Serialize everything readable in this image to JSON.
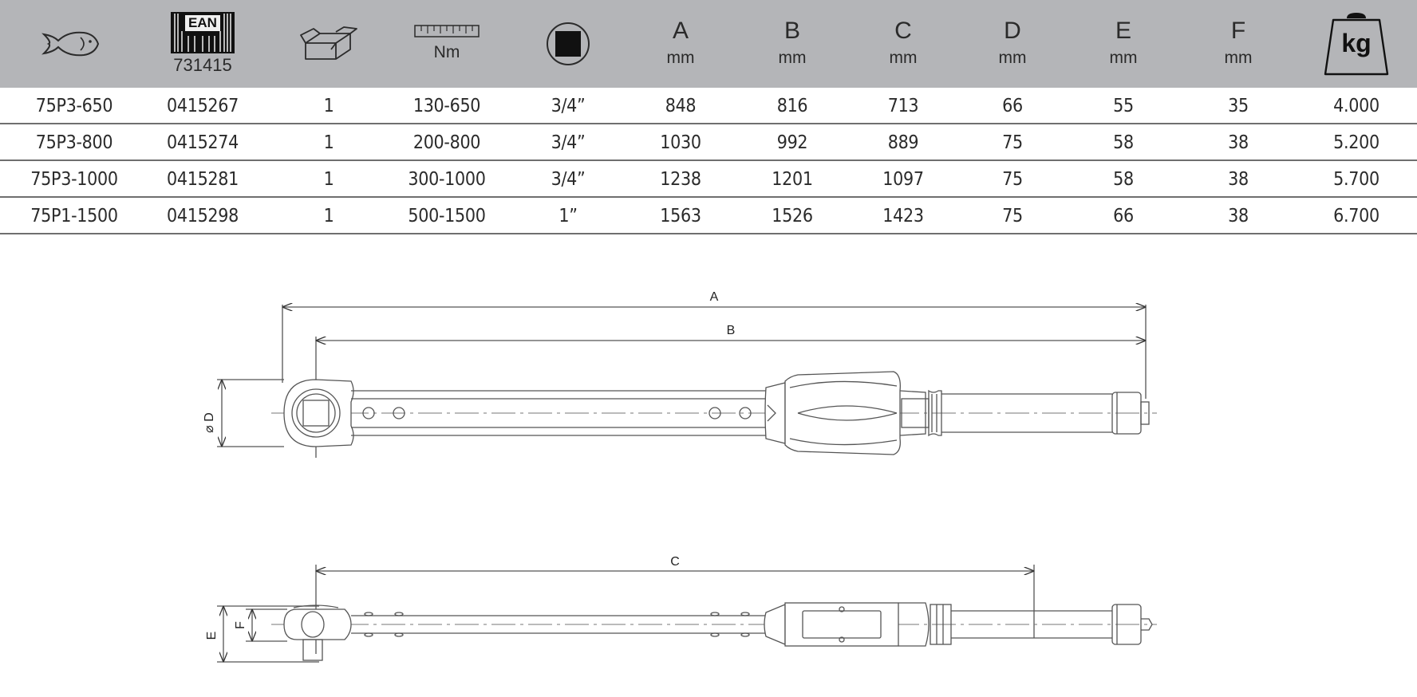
{
  "header": {
    "ean_logo_text": "EAN",
    "ean_code": "731415",
    "torque_unit": "Nm",
    "columns": [
      {
        "letter": "A",
        "unit": "mm"
      },
      {
        "letter": "B",
        "unit": "mm"
      },
      {
        "letter": "C",
        "unit": "mm"
      },
      {
        "letter": "D",
        "unit": "mm"
      },
      {
        "letter": "E",
        "unit": "mm"
      },
      {
        "letter": "F",
        "unit": "mm"
      }
    ],
    "weight_unit": "kg",
    "icons": [
      "fish-icon",
      "ean-barcode-icon",
      "package-box-icon",
      "ruler-scale-icon",
      "square-drive-icon",
      "weight-icon"
    ]
  },
  "rows": [
    [
      "75P3-650",
      "0415267",
      "1",
      "130-650",
      "3/4”",
      "848",
      "816",
      "713",
      "66",
      "55",
      "35",
      "4.000"
    ],
    [
      "75P3-800",
      "0415274",
      "1",
      "200-800",
      "3/4”",
      "1030",
      "992",
      "889",
      "75",
      "58",
      "38",
      "5.200"
    ],
    [
      "75P3-1000",
      "0415281",
      "1",
      "300-1000",
      "3/4”",
      "1238",
      "1201",
      "1097",
      "75",
      "58",
      "38",
      "5.700"
    ],
    [
      "75P1-1500",
      "0415298",
      "1",
      "500-1500",
      "1”",
      "1563",
      "1526",
      "1423",
      "75",
      "66",
      "38",
      "6.700"
    ]
  ],
  "drawing": {
    "dim_a": "A",
    "dim_b": "B",
    "dim_c": "C",
    "dim_d": "⌀ D",
    "dim_e": "E",
    "dim_f": "F"
  }
}
